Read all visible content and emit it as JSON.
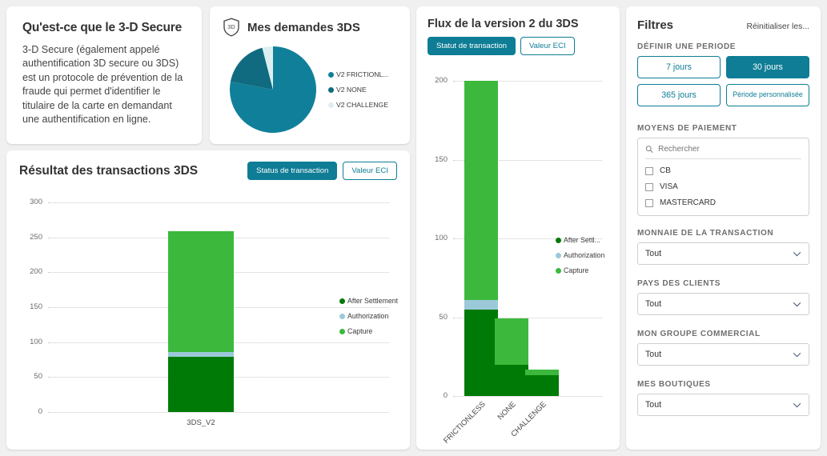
{
  "info_card": {
    "title": "Qu'est-ce que le 3-D Secure",
    "body": "3-D Secure (également appelé authentification 3D secure ou 3DS) est un protocole de prévention de la fraude qui permet d'identifier le titulaire de la carte en demandant une authentification en ligne."
  },
  "pie_card": {
    "icon": "shield-3d-icon",
    "icon_text": "3D",
    "title": "Mes demandes 3DS"
  },
  "bar_card": {
    "title": "Résultat des transactions 3DS",
    "tabs": [
      {
        "label": "Status de transaction",
        "active": true
      },
      {
        "label": "Valeur ECI",
        "active": false
      }
    ]
  },
  "flux_card": {
    "title": "Flux de la version 2 du 3DS",
    "tabs": [
      {
        "label": "Statut de transaction",
        "active": true
      },
      {
        "label": "Valeur ECI",
        "active": false
      }
    ]
  },
  "filters": {
    "title": "Filtres",
    "reset_label": "Réinitialiser les...",
    "period_label": "DÉFINIR UNE PERIODE",
    "period_buttons": [
      {
        "label": "7 jours",
        "active": false
      },
      {
        "label": "30 jours",
        "active": true
      },
      {
        "label": "365 jours",
        "active": false
      },
      {
        "label": "Période personnalisée",
        "active": false
      }
    ],
    "payment_label": "MOYENS DE PAIEMENT",
    "search_placeholder": "Rechercher",
    "search_value": "",
    "payment_options": [
      {
        "label": "CB",
        "checked": false
      },
      {
        "label": "VISA",
        "checked": false
      },
      {
        "label": "MASTERCARD",
        "checked": false
      }
    ],
    "currency_label": "MONNAIE DE LA TRANSACTION",
    "currency_value": "Tout",
    "country_label": "PAYS DES CLIENTS",
    "country_value": "Tout",
    "group_label": "MON GROUPE COMMERCIAL",
    "group_value": "Tout",
    "shops_label": "MES BOUTIQUES",
    "shops_value": "Tout"
  },
  "colors": {
    "accent_teal": "#0e7d95",
    "pie_frictionless": "#10809a",
    "pie_none": "#106b80",
    "pie_challenge": "#dceef1",
    "after_settlement": "#007a07",
    "authorization": "#9bc9d9",
    "capture": "#3cb93c"
  },
  "chart_data": [
    {
      "type": "pie",
      "title": "Mes demandes 3DS",
      "labels": [
        "V2 FRICTIONL...",
        "V2 NONE",
        "V2 CHALLENGE"
      ],
      "values": [
        78,
        18,
        4
      ],
      "colors": [
        "#10809a",
        "#106b80",
        "#dceef1"
      ],
      "legend": "right"
    },
    {
      "type": "bar",
      "title": "Résultat des transactions 3DS",
      "stacked": true,
      "categories": [
        "3DS_V2"
      ],
      "series": [
        {
          "name": "After Settlement",
          "values": [
            79
          ],
          "color": "#007a07"
        },
        {
          "name": "Authorization",
          "values": [
            7
          ],
          "color": "#9bc9d9"
        },
        {
          "name": "Capture",
          "values": [
            173
          ],
          "color": "#3cb93c"
        }
      ],
      "yticks": [
        0,
        50,
        100,
        150,
        200,
        250,
        300
      ],
      "ylim": [
        0,
        300
      ],
      "xlabel": "",
      "ylabel": "",
      "grid": true,
      "legend": "right"
    },
    {
      "type": "bar",
      "title": "Flux de la version 2 du 3DS",
      "stacked": true,
      "categories": [
        "FRICTIONLESS",
        "NONE",
        "CHALLENGE"
      ],
      "series": [
        {
          "name": "After Settl...",
          "values": [
            55,
            20,
            13
          ],
          "color": "#007a07"
        },
        {
          "name": "Authorization",
          "values": [
            6,
            0,
            0
          ],
          "color": "#9bc9d9"
        },
        {
          "name": "Capture",
          "values": [
            139,
            29,
            4
          ],
          "color": "#3cb93c"
        }
      ],
      "yticks": [
        0,
        50,
        100,
        150,
        200
      ],
      "ylim": [
        0,
        200
      ],
      "xlabel": "",
      "ylabel": "",
      "grid": true,
      "legend": "right"
    }
  ]
}
